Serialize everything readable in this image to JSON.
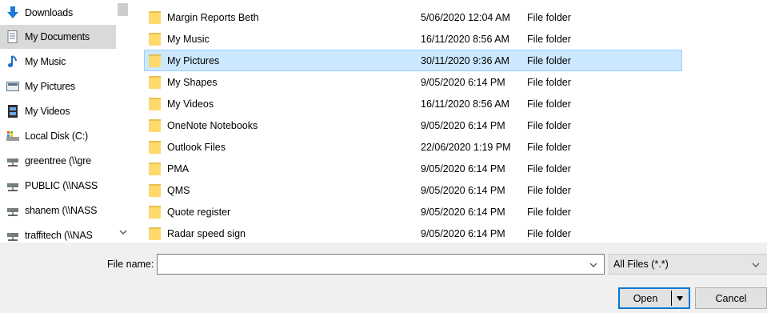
{
  "nav": {
    "items": [
      {
        "label": "Downloads",
        "icon": "downloads-icon",
        "selected": false
      },
      {
        "label": "My Documents",
        "icon": "documents-icon",
        "selected": true
      },
      {
        "label": "My Music",
        "icon": "music-icon",
        "selected": false
      },
      {
        "label": "My Pictures",
        "icon": "pictures-icon",
        "selected": false
      },
      {
        "label": "My Videos",
        "icon": "videos-icon",
        "selected": false
      },
      {
        "label": "Local Disk (C:)",
        "icon": "local-disk-icon",
        "selected": false
      },
      {
        "label": "greentree (\\\\gre",
        "icon": "network-drive-icon",
        "selected": false
      },
      {
        "label": "PUBLIC (\\\\NASS",
        "icon": "network-drive-icon",
        "selected": false
      },
      {
        "label": "shanem (\\\\NASS",
        "icon": "network-drive-icon",
        "selected": false
      },
      {
        "label": "traffitech (\\\\NAS",
        "icon": "network-drive-icon",
        "selected": false
      }
    ]
  },
  "files": [
    {
      "name": "Margin Reports Beth",
      "date": "5/06/2020 12:04 AM",
      "type": "File folder",
      "selected": false
    },
    {
      "name": "My Music",
      "date": "16/11/2020 8:56 AM",
      "type": "File folder",
      "selected": false
    },
    {
      "name": "My Pictures",
      "date": "30/11/2020 9:36 AM",
      "type": "File folder",
      "selected": true
    },
    {
      "name": "My Shapes",
      "date": "9/05/2020 6:14 PM",
      "type": "File folder",
      "selected": false
    },
    {
      "name": "My Videos",
      "date": "16/11/2020 8:56 AM",
      "type": "File folder",
      "selected": false
    },
    {
      "name": "OneNote Notebooks",
      "date": "9/05/2020 6:14 PM",
      "type": "File folder",
      "selected": false
    },
    {
      "name": "Outlook Files",
      "date": "22/06/2020 1:19 PM",
      "type": "File folder",
      "selected": false
    },
    {
      "name": "PMA",
      "date": "9/05/2020 6:14 PM",
      "type": "File folder",
      "selected": false
    },
    {
      "name": "QMS",
      "date": "9/05/2020 6:14 PM",
      "type": "File folder",
      "selected": false
    },
    {
      "name": "Quote register",
      "date": "9/05/2020 6:14 PM",
      "type": "File folder",
      "selected": false
    },
    {
      "name": "Radar speed sign",
      "date": "9/05/2020 6:14 PM",
      "type": "File folder",
      "selected": false
    }
  ],
  "footer": {
    "filename_label": "File name:",
    "filename_value": "",
    "filter_value": "All Files (*.*)",
    "open_label": "Open",
    "cancel_label": "Cancel"
  },
  "colors": {
    "selected_row_bg": "#cce8ff",
    "selected_row_border": "#99d1ff",
    "nav_selected_bg": "#d9d9d9",
    "folder": "#ffd96b",
    "accent": "#0078d7"
  }
}
